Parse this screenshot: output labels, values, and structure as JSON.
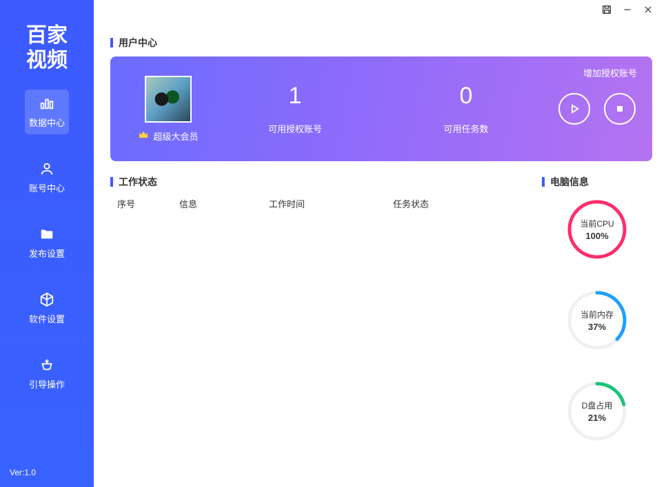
{
  "app": {
    "logo_line1": "百家",
    "logo_line2": "视频",
    "version": "Ver:1.0"
  },
  "sidebar": {
    "items": [
      {
        "label": "数据中心"
      },
      {
        "label": "账号中心"
      },
      {
        "label": "发布设置"
      },
      {
        "label": "软件设置"
      },
      {
        "label": "引导操作"
      }
    ]
  },
  "user_center": {
    "title": "用户中心",
    "member_label": "超级大会员",
    "add_auth_label": "增加授权账号",
    "stats": [
      {
        "value": "1",
        "label": "可用授权账号"
      },
      {
        "value": "0",
        "label": "可用任务数"
      }
    ]
  },
  "work_status": {
    "title": "工作状态",
    "columns": [
      "序号",
      "信息",
      "工作时间",
      "任务状态"
    ],
    "rows": []
  },
  "pc_info": {
    "title": "电脑信息",
    "gauges": [
      {
        "label": "当前CPU",
        "value_text": "100%",
        "percent": 100,
        "color": "#ff2d6b"
      },
      {
        "label": "当前内存",
        "value_text": "37%",
        "percent": 37,
        "color": "#1ea0ff"
      },
      {
        "label": "D盘占用",
        "value_text": "21%",
        "percent": 21,
        "color": "#18c47a"
      }
    ]
  },
  "chart_data": [
    {
      "type": "pie",
      "title": "当前CPU",
      "categories": [
        "used",
        "free"
      ],
      "values": [
        100,
        0
      ]
    },
    {
      "type": "pie",
      "title": "当前内存",
      "categories": [
        "used",
        "free"
      ],
      "values": [
        37,
        63
      ]
    },
    {
      "type": "pie",
      "title": "D盘占用",
      "categories": [
        "used",
        "free"
      ],
      "values": [
        21,
        79
      ]
    }
  ]
}
